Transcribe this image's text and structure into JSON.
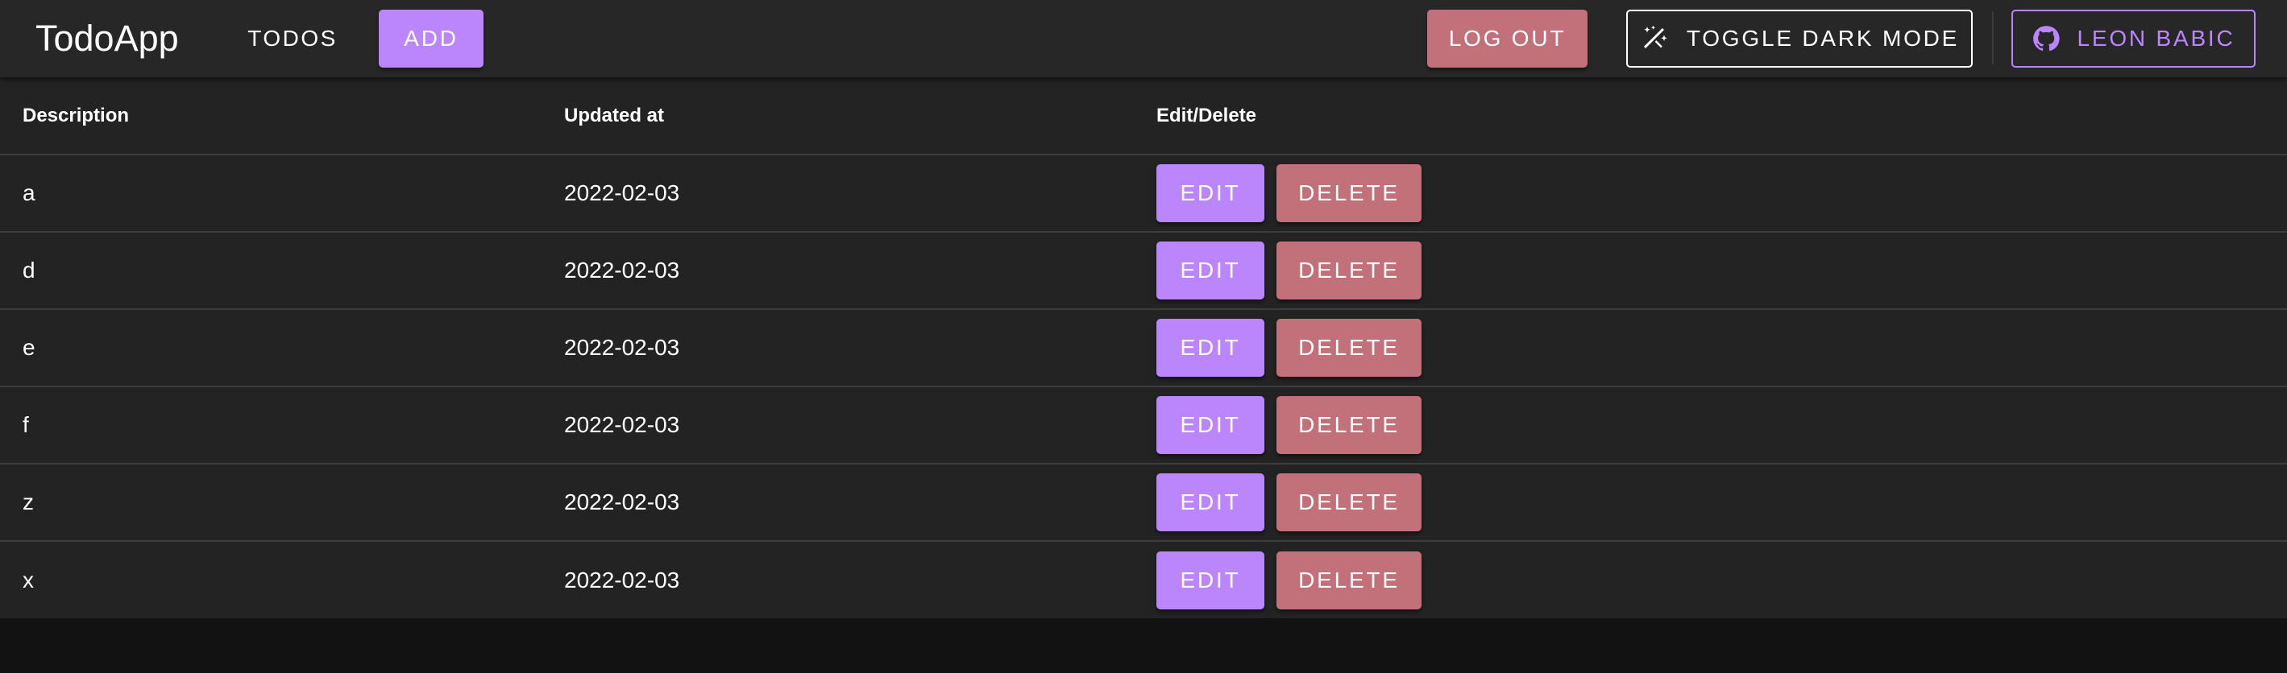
{
  "appbar": {
    "brand": "TodoApp",
    "nav_todos": "TODOS",
    "add_label": "ADD",
    "logout_label": "LOG OUT",
    "toggle_dark_label": "TOGGLE DARK MODE",
    "github_label": "LEON BABIC",
    "icons": {
      "toggle": "dark-mode-wand-icon",
      "github": "github-icon"
    }
  },
  "table": {
    "headers": {
      "description": "Description",
      "updated_at": "Updated at",
      "edit_delete": "Edit/Delete"
    },
    "rows": [
      {
        "description": "a",
        "updated_at": "2022-02-03"
      },
      {
        "description": "d",
        "updated_at": "2022-02-03"
      },
      {
        "description": "e",
        "updated_at": "2022-02-03"
      },
      {
        "description": "f",
        "updated_at": "2022-02-03"
      },
      {
        "description": "z",
        "updated_at": "2022-02-03"
      },
      {
        "description": "x",
        "updated_at": "2022-02-03"
      }
    ],
    "edit_label": "EDIT",
    "delete_label": "DELETE"
  },
  "colors": {
    "primary": "#bb86fc",
    "danger": "#c2707a",
    "appbar_bg": "#272727",
    "table_bg": "#232323",
    "page_bg": "#121212"
  }
}
